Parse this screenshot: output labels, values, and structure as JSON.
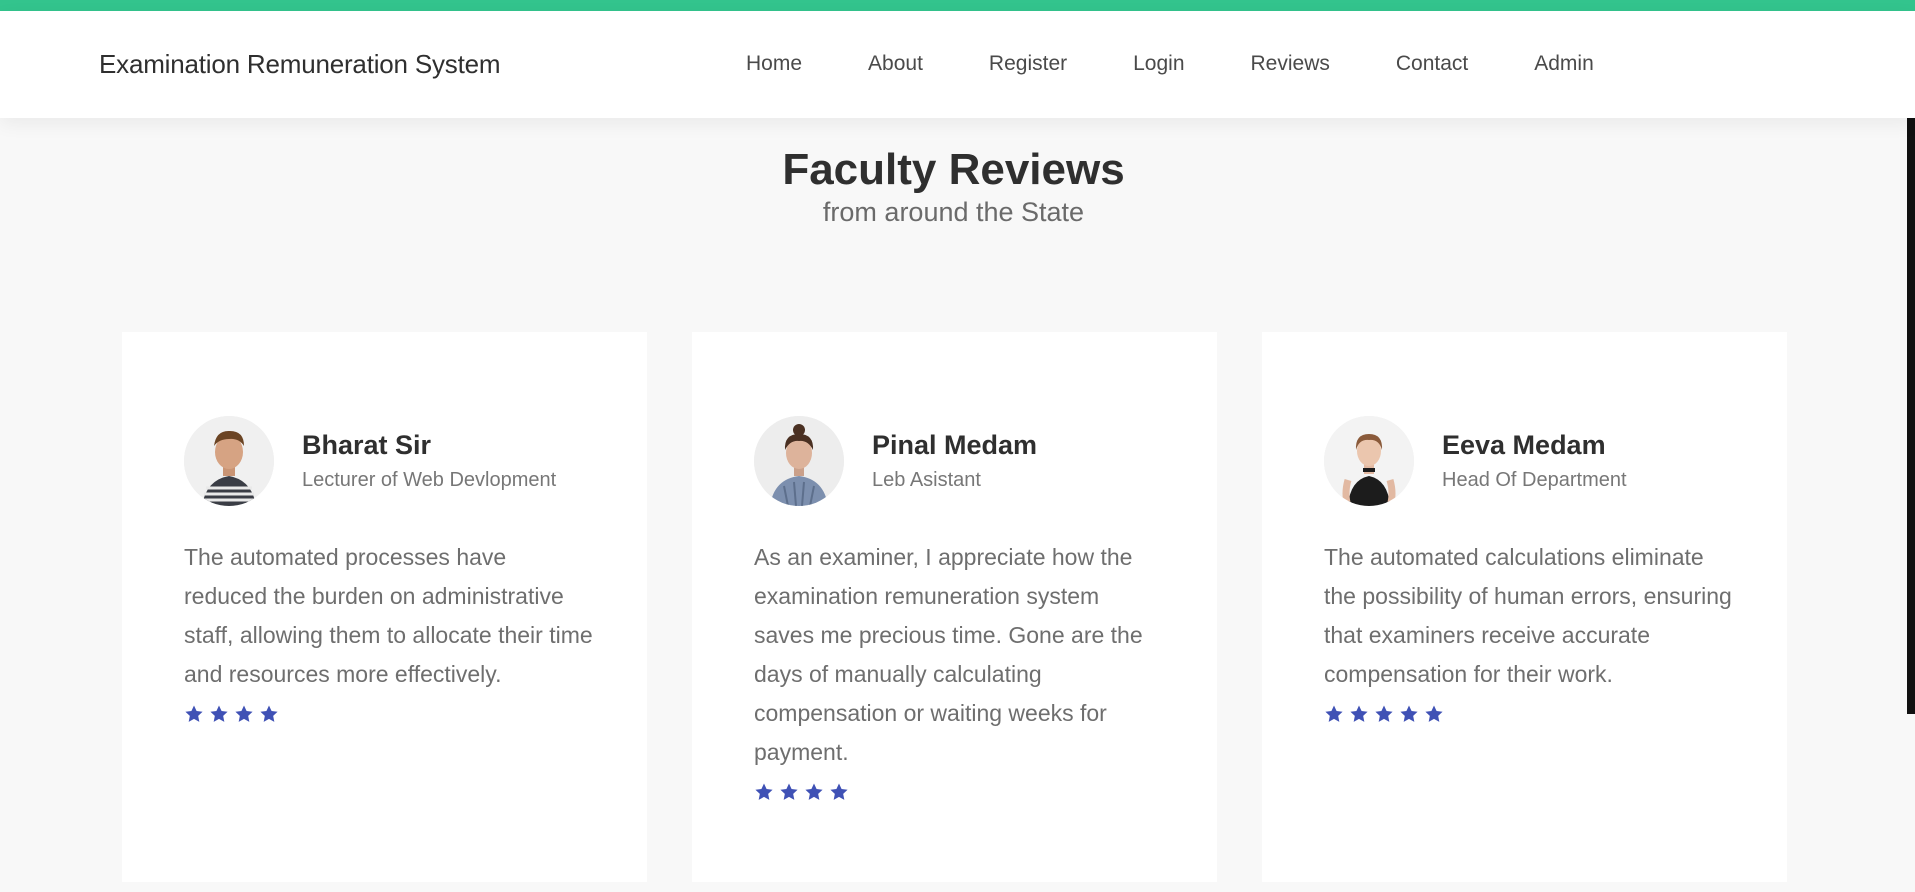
{
  "brand": "Examination Remuneration System",
  "nav": [
    "Home",
    "About",
    "Register",
    "Login",
    "Reviews",
    "Contact",
    "Admin"
  ],
  "section": {
    "title": "Faculty Reviews",
    "subtitle": "from around the State"
  },
  "reviews": [
    {
      "name": "Bharat Sir",
      "role": "Lecturer of Web Devlopment",
      "text": "The automated processes have reduced the burden on administrative staff, allowing them to allocate their time and resources more effectively.",
      "rating": 4
    },
    {
      "name": "Pinal Medam",
      "role": "Leb Asistant",
      "text": "As an examiner, I appreciate how the examination remuneration system saves me precious time. Gone are the days of manually calculating compensation or waiting weeks for payment.",
      "rating": 4
    },
    {
      "name": "Eeva Medam",
      "role": "Head Of Department",
      "text": "The automated calculations eliminate the possibility of human errors, ensuring that examiners receive accurate compensation for their work.",
      "rating": 5
    }
  ],
  "colors": {
    "accent": "#33c48d",
    "star": "#3f51b5"
  },
  "icons": {
    "rating": "star-icon"
  }
}
